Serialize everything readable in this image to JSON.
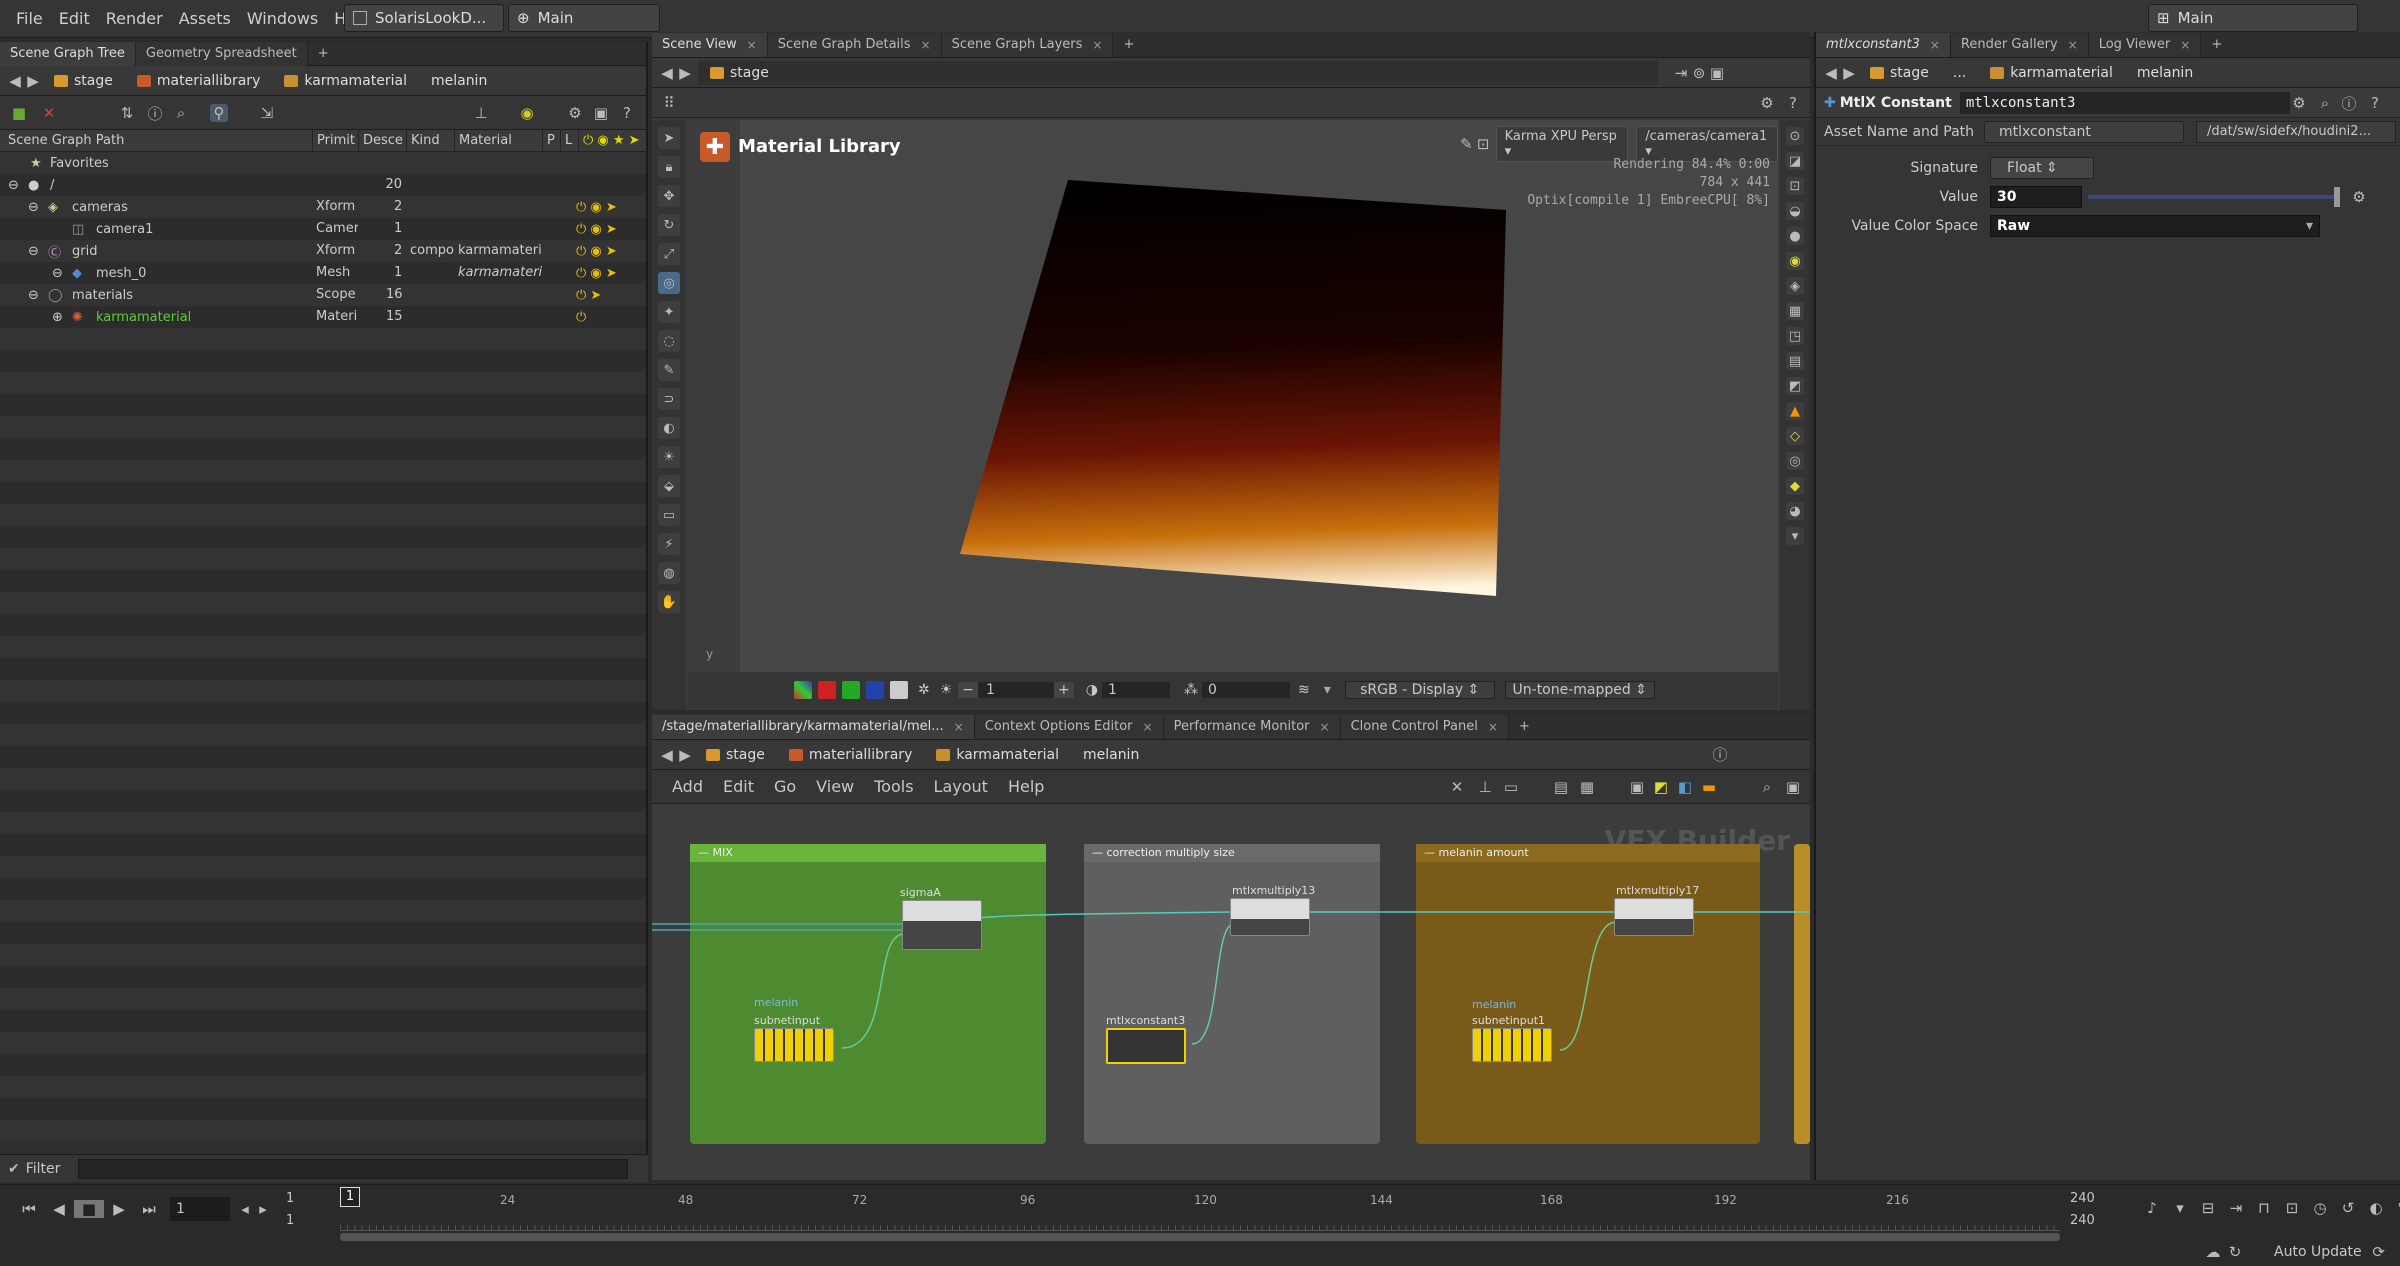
{
  "menu": [
    "File",
    "Edit",
    "Render",
    "Assets",
    "Windows",
    "Help"
  ],
  "desktop": {
    "name": "SolarisLookD...",
    "context": "Main",
    "right_context": "Main"
  },
  "left_panel": {
    "tabs": [
      "Scene Graph Tree",
      "Geometry Spreadsheet"
    ],
    "path": {
      "crumbs": [
        "stage",
        "materiallibrary",
        "karmamaterial"
      ],
      "current": "melanin"
    },
    "columns": [
      "Scene Graph Path",
      "Primit",
      "Desce",
      "Kind",
      "Material",
      "P",
      "L"
    ],
    "rows": [
      {
        "name": "Favorites",
        "type": "",
        "desc": "",
        "kind": "",
        "mat": ""
      },
      {
        "name": "/",
        "type": "",
        "desc": "20",
        "kind": "",
        "mat": ""
      },
      {
        "name": "cameras",
        "type": "Xform",
        "desc": "2",
        "kind": "",
        "mat": ""
      },
      {
        "name": "camera1",
        "type": "Camer",
        "desc": "1",
        "kind": "",
        "mat": ""
      },
      {
        "name": "grid",
        "type": "Xform",
        "desc": "2",
        "kind": "compo",
        "mat": "karmamateri"
      },
      {
        "name": "mesh_0",
        "type": "Mesh",
        "desc": "1",
        "kind": "",
        "mat": "karmamateri"
      },
      {
        "name": "materials",
        "type": "Scope",
        "desc": "16",
        "kind": "",
        "mat": ""
      },
      {
        "name": "karmamaterial",
        "type": "Materi",
        "desc": "15",
        "kind": "",
        "mat": ""
      }
    ],
    "filter_label": "Filter"
  },
  "viewer": {
    "tabs": [
      "Scene View",
      "Scene Graph Details",
      "Scene Graph Layers"
    ],
    "path": "stage",
    "node_title": "Material Library",
    "renderer": "Karma XPU Persp",
    "camera": "/cameras/camera1",
    "stats": [
      "Rendering  84.4%  0:00",
      "784 x 441",
      "Optix[compile 1] EmbreeCPU[ 8%]"
    ],
    "bottom": {
      "field1": "1",
      "field2": "1",
      "field3": "0",
      "display": "sRGB - Display",
      "tone": "Un-tone-mapped"
    },
    "render_gradient": {
      "top": "#000000",
      "mid": "#5a0f05",
      "low": "#d47a10",
      "bottom": "#fff8e8"
    }
  },
  "network": {
    "tabs": [
      "/stage/materiallibrary/karmamaterial/mel...",
      "Context Options Editor",
      "Performance Monitor",
      "Clone Control Panel"
    ],
    "crumbs": [
      "stage",
      "materiallibrary",
      "karmamaterial"
    ],
    "current": "melanin",
    "menu": [
      "Add",
      "Edit",
      "Go",
      "View",
      "Tools",
      "Layout",
      "Help"
    ],
    "watermark": "VEX Builder",
    "boxes": [
      {
        "title": "MIX",
        "color": "#4e8a30"
      },
      {
        "title": "correction multiply size",
        "color": "#5f5f5f"
      },
      {
        "title": "melanin amount",
        "color": "#7a5a18"
      }
    ],
    "nodes": {
      "sigmaA": "sigmaA",
      "sub1_label": "melanin",
      "sub1": "subnetinput",
      "const": "mtlxconstant3",
      "mult13": "mtlxmultiply13",
      "mult17": "mtlxmultiply17",
      "sub2_label": "melanin",
      "sub2": "subnetinput1"
    }
  },
  "params": {
    "tabs": [
      "mtlxconstant3",
      "Render Gallery",
      "Log Viewer"
    ],
    "crumbs": [
      "stage",
      "...",
      "karmamaterial"
    ],
    "current": "melanin",
    "node_type": "MtlX Constant",
    "node_name": "mtlxconstant3",
    "asset_label": "Asset Name and Path",
    "asset_value": "mtlxconstant",
    "asset_path": "/dat/sw/sidefx/houdini2...",
    "signature_label": "Signature",
    "signature": "Float",
    "value_label": "Value",
    "value": "30",
    "colorspace_label": "Value Color Space",
    "colorspace": "Raw"
  },
  "timeline": {
    "frame": "1",
    "ticks": [
      "24",
      "48",
      "72",
      "96",
      "120",
      "144",
      "168",
      "192",
      "216"
    ],
    "start": "1",
    "start2": "1",
    "end": "240",
    "end2": "240",
    "auto_update": "Auto Update"
  }
}
